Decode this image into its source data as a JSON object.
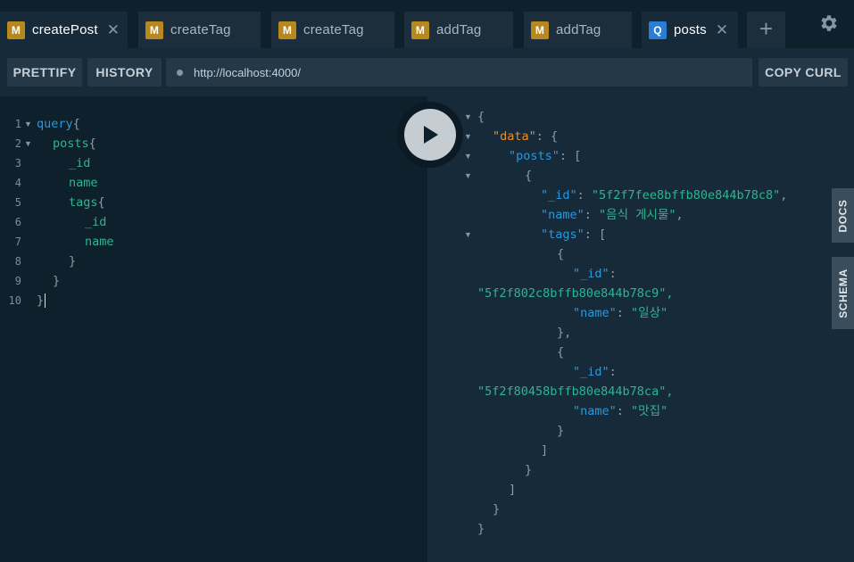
{
  "tabs": [
    {
      "badge": "M",
      "label": "createPost",
      "close": "✕"
    },
    {
      "badge": "M",
      "label": "createTag"
    },
    {
      "badge": "M",
      "label": "createTag"
    },
    {
      "badge": "M",
      "label": "addTag"
    },
    {
      "badge": "M",
      "label": "addTag"
    },
    {
      "badge": "Q",
      "label": "posts",
      "close": "✕"
    }
  ],
  "add_tab_label": "+",
  "toolbar": {
    "prettify_label": "PRETTIFY",
    "history_label": "HISTORY",
    "url": "http://localhost:4000/",
    "copy_curl_label": "COPY CURL"
  },
  "editor": {
    "line_numbers": [
      "1",
      "2",
      "3",
      "4",
      "5",
      "6",
      "7",
      "8",
      "9",
      "10"
    ],
    "query": {
      "l1_kw": "query",
      "l1_brace": "{",
      "l2_field": "posts",
      "l2_brace": "{",
      "l3_field": "_id",
      "l4_field": "name",
      "l5_field": "tags",
      "l5_brace": "{",
      "l6_field": "_id",
      "l7_field": "name",
      "l8_brace": "}",
      "l9_brace": "}",
      "l10_brace": "}"
    }
  },
  "result": {
    "open_brace": "{",
    "data_key": "\"data\"",
    "colon_brace": ": {",
    "posts_key": "\"posts\"",
    "colon_bracket": ": [",
    "obj_open": "{",
    "id_key": "\"_id\"",
    "colon": ": ",
    "post_id": "\"5f2f7fee8bffb80e844b78c8\"",
    "comma": ",",
    "name_key": "\"name\"",
    "post_name": "\"음식 게시물\"",
    "tags_key": "\"tags\"",
    "tag1_id": "\"5f2f802c8bffb80e844b78c9\",",
    "tag1_name": "\"일상\"",
    "tag_close_comma": "},",
    "tag2_id": "\"5f2f80458bffb80e844b78ca\",",
    "tag2_name": "\"맛집\"",
    "close_brace": "}",
    "close_bracket": "]"
  },
  "side_tabs": {
    "docs": "DOCS",
    "schema": "SCHEMA"
  },
  "colors": {
    "mutation_badge": "#b7881d",
    "query_badge": "#2a7ed2",
    "editor_bg": "#0f202d",
    "result_bg": "#172a3a"
  },
  "icons": {
    "settings": "gear-icon",
    "run": "play-icon",
    "close": "close-icon",
    "fold": "fold-arrow-icon"
  }
}
